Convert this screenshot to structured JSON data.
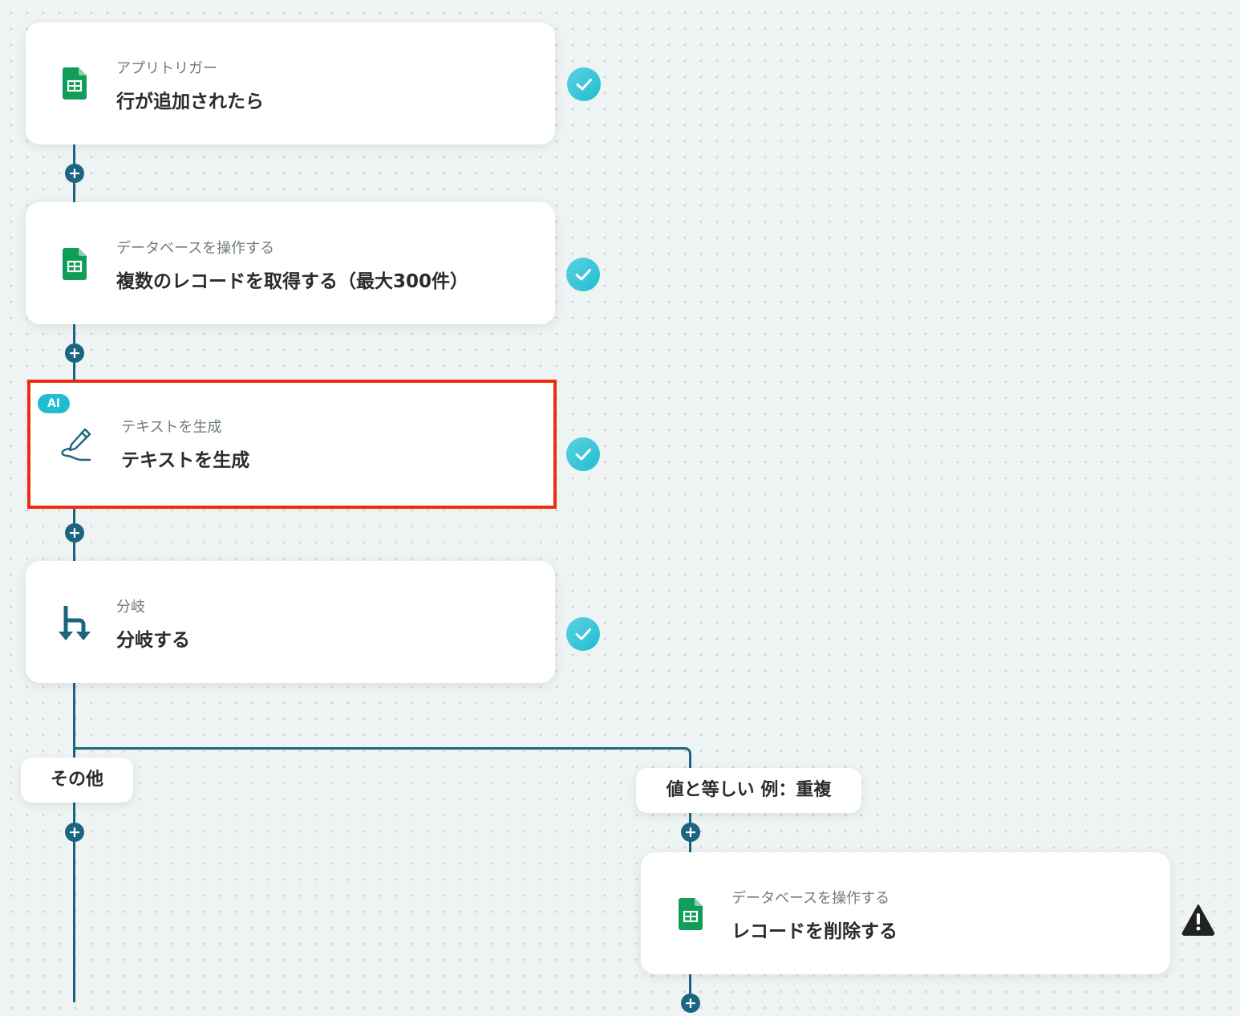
{
  "steps": [
    {
      "subtitle": "アプリトリガー",
      "title": "行が追加されたら",
      "icon": "google-sheets-icon",
      "status": "complete"
    },
    {
      "subtitle": "データベースを操作する",
      "title": "複数のレコードを取得する（最大300件）",
      "icon": "google-sheets-icon",
      "status": "complete"
    },
    {
      "subtitle": "テキストを生成",
      "title": "テキストを生成",
      "icon": "ai-text-generation-icon",
      "badge": "AI",
      "status": "complete",
      "highlighted": true
    },
    {
      "subtitle": "分岐",
      "title": "分岐する",
      "icon": "branch-icon",
      "status": "complete"
    }
  ],
  "branches": {
    "left": {
      "label": "その他"
    },
    "right": {
      "label": "値と等しい 例：重複"
    }
  },
  "branch_step": {
    "subtitle": "データベースを操作する",
    "title": "レコードを削除する",
    "icon": "google-sheets-icon",
    "status": "warning"
  },
  "colors": {
    "connector": "#1c6580",
    "check": "#21bdd2",
    "highlight": "#ee2d10",
    "sheets_green": "#0f9d58",
    "warning": "#222222"
  }
}
